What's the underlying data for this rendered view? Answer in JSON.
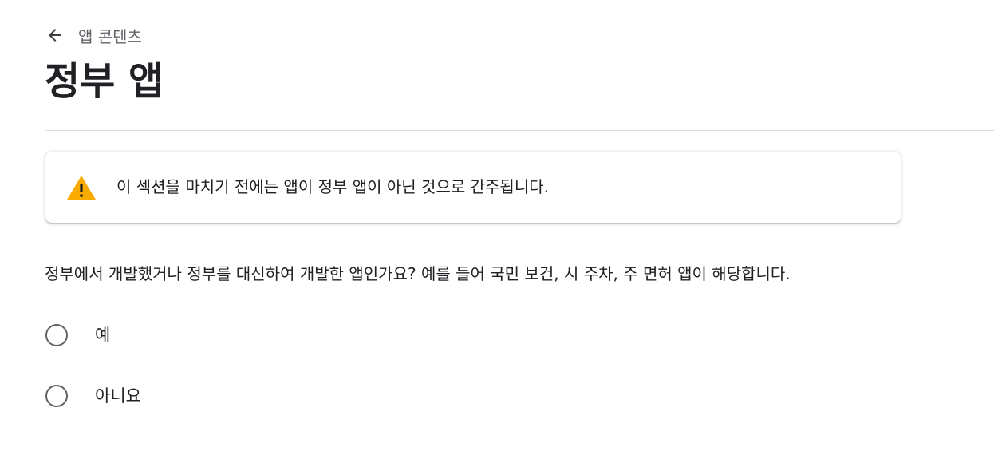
{
  "header": {
    "back_label": "앱 콘텐츠",
    "title": "정부 앱"
  },
  "warning": {
    "icon": "warning-icon",
    "text": "이 섹션을 마치기 전에는 앱이 정부 앱이 아닌 것으로 간주됩니다.",
    "icon_color": "#f9ab00"
  },
  "question": {
    "text": "정부에서 개발했거나 정부를 대신하여 개발한 앱인가요? 예를 들어 국민 보건, 시 주차, 주 면허 앱이 해당합니다.",
    "options": [
      {
        "label": "예",
        "selected": false
      },
      {
        "label": "아니요",
        "selected": false
      }
    ]
  }
}
